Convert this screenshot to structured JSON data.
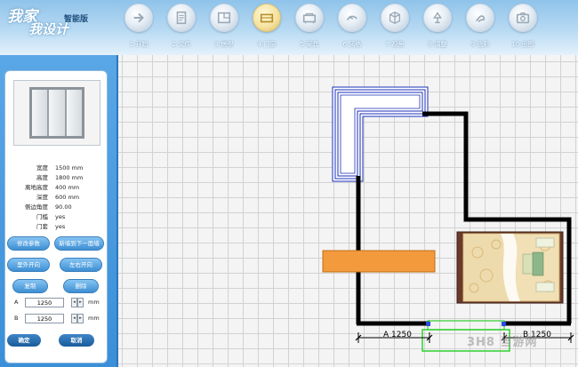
{
  "app": {
    "logo_line1": "我家",
    "logo_line2": "我设计",
    "edition": "智能版"
  },
  "toolbar": [
    {
      "label": "1 开始",
      "icon": "arrow-right-icon",
      "active": false
    },
    {
      "label": "2 文件",
      "icon": "file-icon",
      "active": false
    },
    {
      "label": "3 房型",
      "icon": "floorplan-icon",
      "active": false
    },
    {
      "label": "4 门窗",
      "icon": "door-window-icon",
      "active": true
    },
    {
      "label": "5 家具",
      "icon": "furniture-icon",
      "active": false
    },
    {
      "label": "6 风格",
      "icon": "style-icon",
      "active": false
    },
    {
      "label": "7 视角",
      "icon": "cube-view-icon",
      "active": false
    },
    {
      "label": "8 调整",
      "icon": "lamp-adjust-icon",
      "active": false
    },
    {
      "label": "9 色彩",
      "icon": "color-icon",
      "active": false
    },
    {
      "label": "10 出图",
      "icon": "camera-icon",
      "active": false
    }
  ],
  "properties": [
    {
      "key": "宽度",
      "value": "1500 mm"
    },
    {
      "key": "高度",
      "value": "1800 mm"
    },
    {
      "key": "离地高度",
      "value": "400 mm"
    },
    {
      "key": "深度",
      "value": "600 mm"
    },
    {
      "key": "侧边角度",
      "value": "90.00"
    },
    {
      "key": "门槛",
      "value": "yes"
    },
    {
      "key": "门套",
      "value": "yes"
    }
  ],
  "buttons": {
    "modify_params": "修改参数",
    "next_wall": "新墙到下一面墙",
    "inside_open": "里外开向",
    "left_right_open": "左右开向",
    "copy": "复制",
    "delete": "删除",
    "confirm": "确定",
    "cancel": "取消"
  },
  "dimensions": {
    "a_label": "A",
    "a_value": "1250",
    "b_label": "B",
    "b_value": "1250",
    "unit": "mm"
  },
  "canvas": {
    "dim_a": "A 1250",
    "dim_b": "B 1250"
  },
  "watermark": "3H8 当游网",
  "colors": {
    "panel_blue": "#3b8fd8",
    "wall": "#000000",
    "selection_green": "#2fd02f",
    "wardrobe_orange": "#f39a3c"
  }
}
